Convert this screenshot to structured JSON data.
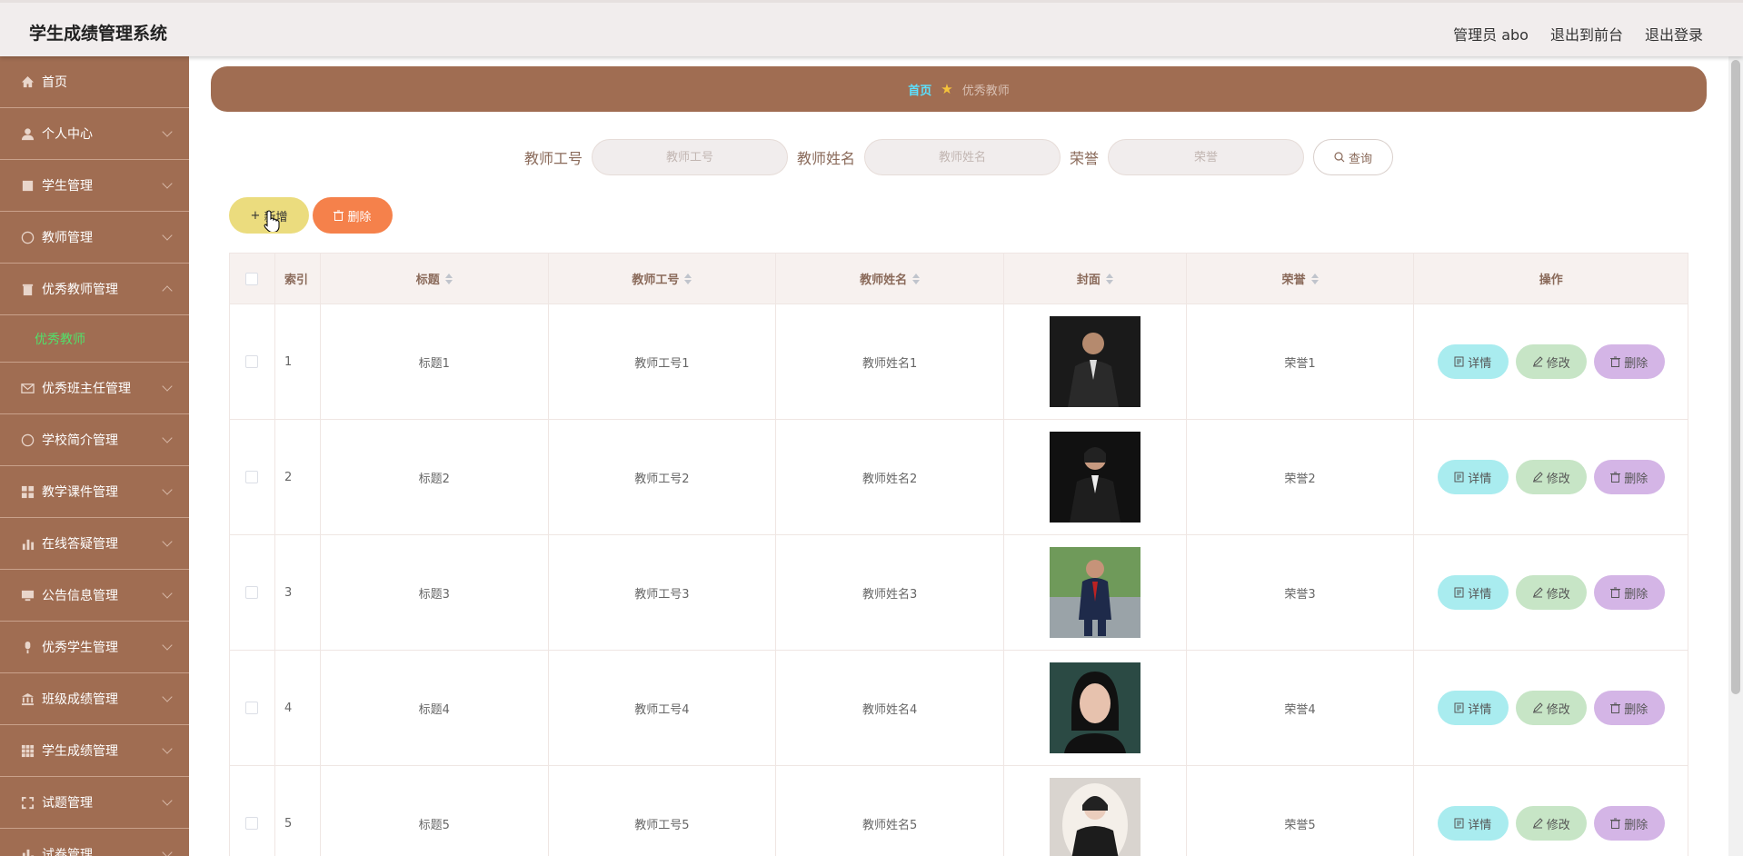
{
  "header": {
    "title": "学生成绩管理系统",
    "user": "管理员 abo",
    "to_front": "退出到前台",
    "logout": "退出登录"
  },
  "sidebar": {
    "items": [
      {
        "label": "首页",
        "icon": "home-icon"
      },
      {
        "label": "个人中心",
        "icon": "user-icon"
      },
      {
        "label": "学生管理",
        "icon": "document-icon"
      },
      {
        "label": "教师管理",
        "icon": "compass-icon"
      },
      {
        "label": "优秀教师管理",
        "icon": "trash-icon",
        "expanded": true,
        "sub": "优秀教师"
      },
      {
        "label": "优秀班主任管理",
        "icon": "mail-icon"
      },
      {
        "label": "学校简介管理",
        "icon": "globe-icon"
      },
      {
        "label": "教学课件管理",
        "icon": "grid-icon"
      },
      {
        "label": "在线答疑管理",
        "icon": "bar-chart-icon"
      },
      {
        "label": "公告信息管理",
        "icon": "monitor-icon"
      },
      {
        "label": "优秀学生管理",
        "icon": "microphone-icon"
      },
      {
        "label": "班级成绩管理",
        "icon": "bank-icon"
      },
      {
        "label": "学生成绩管理",
        "icon": "table-icon"
      },
      {
        "label": "试题管理",
        "icon": "fullscreen-icon"
      },
      {
        "label": "试卷管理",
        "icon": "chart-icon"
      }
    ]
  },
  "breadcrumb": {
    "home": "首页",
    "current": "优秀教师"
  },
  "search": {
    "tid_label": "教师工号",
    "tid_placeholder": "教师工号",
    "tname_label": "教师姓名",
    "tname_placeholder": "教师姓名",
    "honor_label": "荣誉",
    "honor_placeholder": "荣誉",
    "query": "查询"
  },
  "actions": {
    "add": "新增",
    "delete": "删除"
  },
  "table": {
    "headers": {
      "index": "索引",
      "title": "标题",
      "tid": "教师工号",
      "tname": "教师姓名",
      "cover": "封面",
      "honor": "荣誉",
      "op": "操作"
    },
    "rows": [
      {
        "index": "1",
        "title": "标题1",
        "tid": "教师工号1",
        "tname": "教师姓名1",
        "honor": "荣誉1"
      },
      {
        "index": "2",
        "title": "标题2",
        "tid": "教师工号2",
        "tname": "教师姓名2",
        "honor": "荣誉2"
      },
      {
        "index": "3",
        "title": "标题3",
        "tid": "教师工号3",
        "tname": "教师姓名3",
        "honor": "荣誉3"
      },
      {
        "index": "4",
        "title": "标题4",
        "tid": "教师工号4",
        "tname": "教师姓名4",
        "honor": "荣誉4"
      },
      {
        "index": "5",
        "title": "标题5",
        "tid": "教师工号5",
        "tname": "教师姓名5",
        "honor": "荣誉5"
      }
    ],
    "ops": {
      "detail": "详情",
      "edit": "修改",
      "delete": "删除"
    }
  },
  "colors": {
    "brand": "#a06d52",
    "header_bg": "#f1eded",
    "active_sub": "#52e06a"
  }
}
